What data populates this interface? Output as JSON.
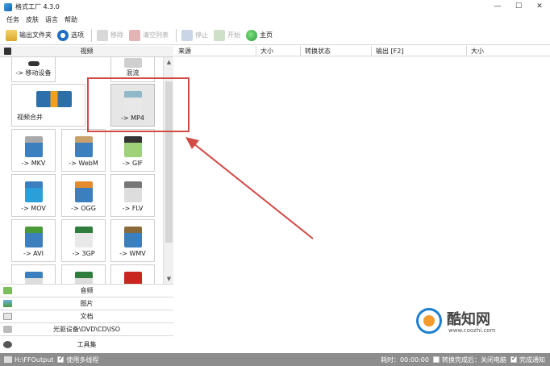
{
  "window": {
    "title": "格式工厂 4.3.0",
    "min": "—",
    "max": "☐",
    "close": "✕"
  },
  "menu": [
    "任务",
    "皮肤",
    "语言",
    "帮助"
  ],
  "toolbar": {
    "output_folder": "输出文件夹",
    "options": "选项",
    "remove": "移除",
    "clear_list": "清空列表",
    "stop": "停止",
    "start": "开始",
    "home": "主页"
  },
  "left": {
    "video_header": "视频",
    "tiles": {
      "mobile": "-> 移动设备",
      "mix": "混流",
      "merge": "视频合并",
      "mp4": "-> MP4",
      "mkv": "-> MKV",
      "webm": "-> WebM",
      "gif": "-> GIF",
      "mov": "-> MOV",
      "ogg": "-> OGG",
      "flv": "-> FLV",
      "avi": "-> AVI",
      "3gp": "-> 3GP",
      "wmv": "-> WMV"
    },
    "categories": [
      "音频",
      "图片",
      "文档",
      "光驱设备\\DVD\\CD\\ISO",
      "工具集"
    ]
  },
  "list": {
    "columns": [
      "来源",
      "大小",
      "转换状态",
      "输出 [F2]",
      "大小"
    ]
  },
  "status": {
    "output_path": "H:\\FFOutput",
    "multithread": "使用多线程",
    "elapsed": "耗时：00:00:00",
    "shutdown": "转换完成后：关闭电脑",
    "notify": "完成通知"
  },
  "watermark": {
    "name": "酷知网",
    "url": "www.coozhi.com"
  },
  "colors": {
    "annotation": "#d24a45",
    "statusbar": "#8d8d8d",
    "accent": "#1d7fd0"
  }
}
